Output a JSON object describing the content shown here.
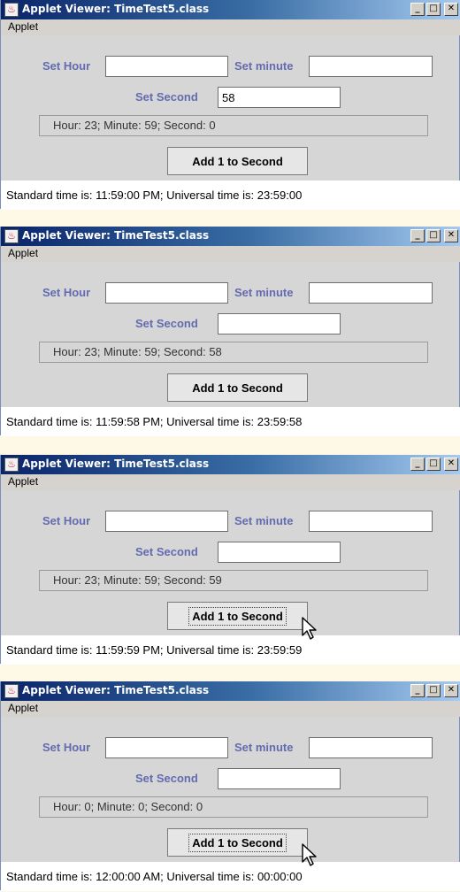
{
  "windows": [
    {
      "title": "Applet Viewer: TimeTest5.class",
      "menu": "Applet",
      "labels": {
        "hour": "Set Hour",
        "minute": "Set minute",
        "second": "Set Second"
      },
      "fields": {
        "hour": "",
        "minute": "",
        "second": "58"
      },
      "output": "Hour: 23; Minute: 59; Second: 0",
      "button": "Add 1 to Second",
      "status": "Standard time is: 11:59:00 PM; Universal time is: 23:59:00"
    },
    {
      "title": "Applet Viewer: TimeTest5.class",
      "menu": "Applet",
      "labels": {
        "hour": "Set Hour",
        "minute": "Set minute",
        "second": "Set Second"
      },
      "fields": {
        "hour": "",
        "minute": "",
        "second": ""
      },
      "output": "Hour: 23; Minute: 59; Second: 58",
      "button": "Add 1 to Second",
      "status": "Standard time is: 11:59:58 PM; Universal time is: 23:59:58"
    },
    {
      "title": "Applet Viewer: TimeTest5.class",
      "menu": "Applet",
      "labels": {
        "hour": "Set Hour",
        "minute": "Set minute",
        "second": "Set Second"
      },
      "fields": {
        "hour": "",
        "minute": "",
        "second": ""
      },
      "output": "Hour: 23; Minute: 59; Second: 59",
      "button": "Add 1 to Second",
      "status": "Standard time is: 11:59:59 PM; Universal time is: 23:59:59"
    },
    {
      "title": "Applet Viewer: TimeTest5.class",
      "menu": "Applet",
      "labels": {
        "hour": "Set Hour",
        "minute": "Set minute",
        "second": "Set Second"
      },
      "fields": {
        "hour": "",
        "minute": "",
        "second": ""
      },
      "output": "Hour: 0; Minute: 0; Second: 0",
      "button": "Add 1 to Second",
      "status": "Standard time is: 12:00:00 AM; Universal time is: 00:00:00"
    }
  ],
  "icons": {
    "app": "java-applet-icon",
    "minimize": "minimize-icon",
    "maximize": "maximize-icon",
    "close": "close-icon",
    "pointer": "mouse-pointer-icon"
  },
  "colors": {
    "titlebar_start": "#0a246a",
    "titlebar_end": "#a6caf0",
    "label": "#636bb0",
    "page_background": "#fef9e6"
  }
}
